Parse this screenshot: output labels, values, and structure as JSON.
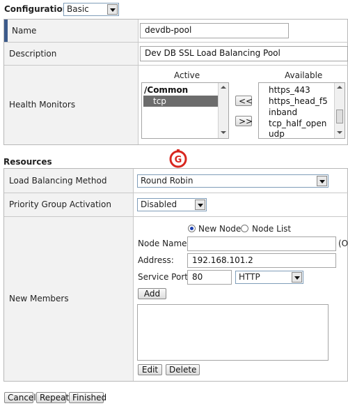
{
  "config": {
    "label": "Configuration:",
    "value": "Basic"
  },
  "general": {
    "name_label": "Name",
    "name_value": "devdb-pool",
    "description_label": "Description",
    "description_value": "Dev DB SSL Load Balancing Pool",
    "monitors_label": "Health Monitors",
    "active_heading": "Active",
    "available_heading": "Available",
    "active_items": [
      "/Common",
      "tcp"
    ],
    "available_items": [
      "https_443",
      "https_head_f5",
      "inband",
      "tcp_half_open",
      "udp"
    ],
    "move_left_label": "<<",
    "move_right_label": ">>"
  },
  "resources": {
    "title": "Resources",
    "method_label": "Load Balancing Method",
    "method_value": "Round Robin",
    "priority_label": "Priority Group Activation",
    "priority_value": "Disabled",
    "members_label": "New Members",
    "radio_new_node": "New Node",
    "radio_node_list": "Node List",
    "node_name_label": "Node Name:",
    "node_name_value": "",
    "node_name_suffix": "(O",
    "address_label": "Address:",
    "address_value": "192.168.101.2",
    "port_label": "Service Port:",
    "port_value": "80",
    "protocol_value": "HTTP",
    "add_label": "Add",
    "edit_label": "Edit",
    "delete_label": "Delete"
  },
  "footer": {
    "cancel": "Cancel",
    "repeat": "Repeat",
    "finished": "Finished"
  },
  "colors": {
    "marker": "#3c5a8a",
    "logo_red": "#d8271f"
  },
  "icons": {
    "logo": "g-logo-icon"
  }
}
